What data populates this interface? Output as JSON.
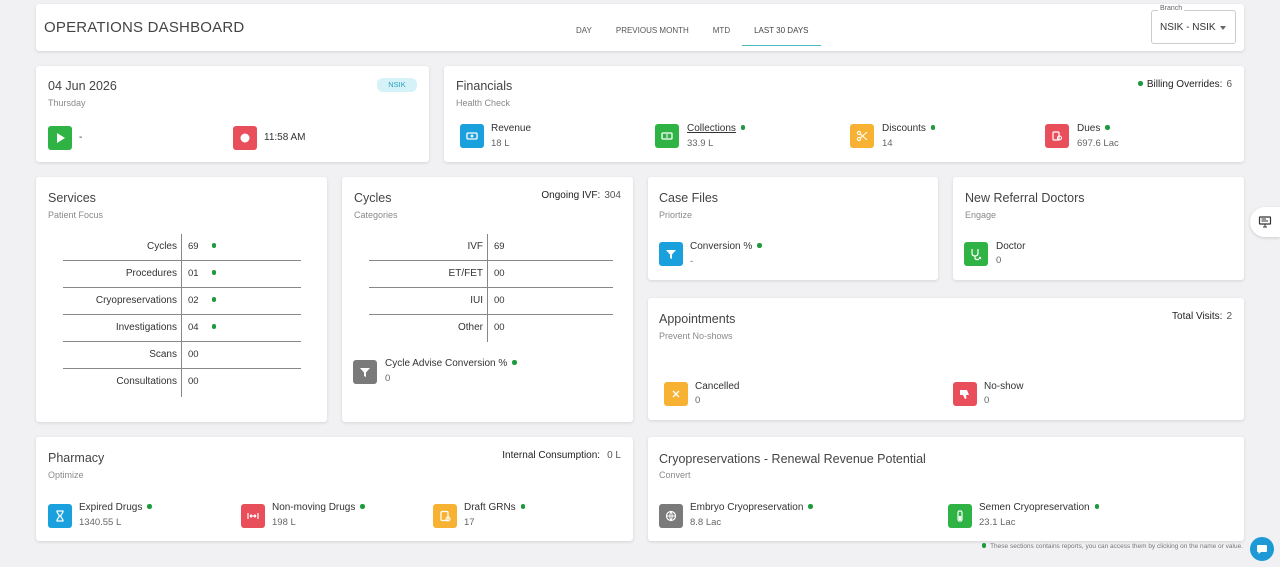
{
  "header": {
    "title": "OPERATIONS DASHBOARD",
    "tabs": [
      {
        "label": "DAY"
      },
      {
        "label": "PREVIOUS MONTH"
      },
      {
        "label": "MTD"
      },
      {
        "label": "LAST 30 DAYS"
      }
    ],
    "active_tab": "LAST 30 DAYS",
    "branch": {
      "label": "Branch",
      "value": "NSIK - NSIK"
    }
  },
  "date_card": {
    "date": "04 Jun 2026",
    "day": "Thursday",
    "badge": "NSIK",
    "start_value": "-",
    "end_time": "11:58 AM"
  },
  "financials": {
    "title": "Financials",
    "subtitle": "Health Check",
    "billing_overrides_label": "Billing Overrides:",
    "billing_overrides_value": "6",
    "items": [
      {
        "label": "Revenue",
        "value": "18 L"
      },
      {
        "label": "Collections",
        "value": "33.9 L"
      },
      {
        "label": "Discounts",
        "value": "14"
      },
      {
        "label": "Dues",
        "value": "697.6 Lac"
      }
    ]
  },
  "services": {
    "title": "Services",
    "subtitle": "Patient Focus",
    "rows": [
      {
        "name": "Cycles",
        "value": "69"
      },
      {
        "name": "Procedures",
        "value": "01"
      },
      {
        "name": "Cryopreservations",
        "value": "02"
      },
      {
        "name": "Investigations",
        "value": "04"
      },
      {
        "name": "Scans",
        "value": "00"
      },
      {
        "name": "Consultations",
        "value": "00"
      }
    ]
  },
  "cycles": {
    "title": "Cycles",
    "subtitle": "Categories",
    "ongoing_label": "Ongoing IVF:",
    "ongoing_value": "304",
    "rows": [
      {
        "name": "IVF",
        "value": "69"
      },
      {
        "name": "ET/FET",
        "value": "00"
      },
      {
        "name": "IUI",
        "value": "00"
      },
      {
        "name": "Other",
        "value": "00"
      }
    ],
    "advise_label": "Cycle Advise Conversion %",
    "advise_value": "0"
  },
  "case_files": {
    "title": "Case Files",
    "subtitle": "Priortize",
    "conversion_label": "Conversion %",
    "conversion_value": "-"
  },
  "referral": {
    "title": "New Referral Doctors",
    "subtitle": "Engage",
    "doctor_label": "Doctor",
    "doctor_value": "0"
  },
  "appointments": {
    "title": "Appointments",
    "subtitle": "Prevent No-shows",
    "total_label": "Total Visits:",
    "total_value": "2",
    "cancelled_label": "Cancelled",
    "cancelled_value": "0",
    "noshow_label": "No-show",
    "noshow_value": "0"
  },
  "pharmacy": {
    "title": "Pharmacy",
    "subtitle": "Optimize",
    "internal_label": "Internal Consumption:",
    "internal_value": "0 L",
    "items": [
      {
        "label": "Expired Drugs",
        "value": "1340.55 L"
      },
      {
        "label": "Non-moving Drugs",
        "value": "198 L"
      },
      {
        "label": "Draft GRNs",
        "value": "17"
      }
    ]
  },
  "cryo": {
    "title": "Cryopreservations - Renewal Revenue Potential",
    "subtitle": "Convert",
    "embryo_label": "Embryo Cryopreservation",
    "embryo_value": "8.8 Lac",
    "semen_label": "Semen Cryopreservation",
    "semen_value": "23.1 Lac"
  },
  "footnote": "These sections contains reports, you can access them by clicking on the name or value.",
  "colors": {
    "play_green": "#2fb344",
    "stop_red": "#e94f5b",
    "blue": "#1aa0dc",
    "green": "#2fb344",
    "orange": "#f7b234",
    "red": "#e94f5b",
    "gray": "#7a7a7a",
    "accent": "#4cb8c4",
    "dot_green": "#1e9a3e"
  }
}
